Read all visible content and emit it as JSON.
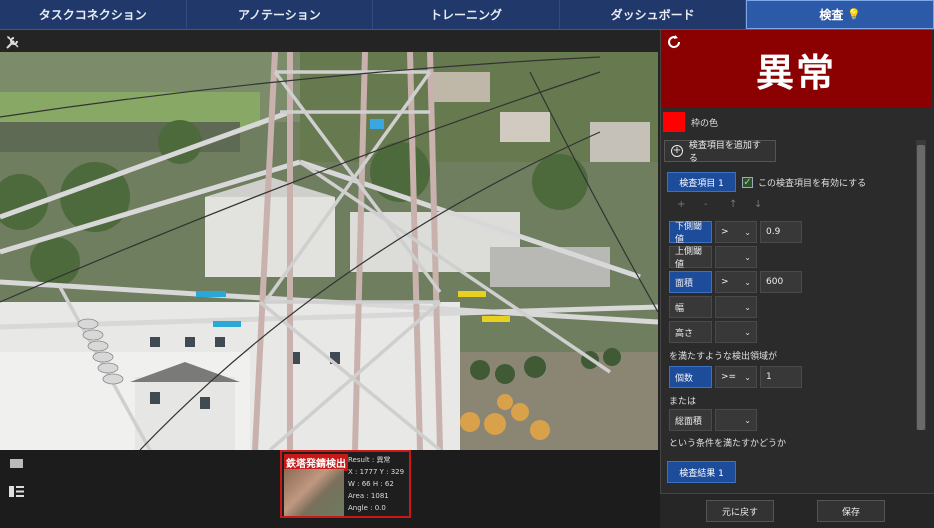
{
  "tabs": [
    {
      "label": "タスクコネクション"
    },
    {
      "label": "アノテーション"
    },
    {
      "label": "トレーニング"
    },
    {
      "label": "ダッシュボード"
    },
    {
      "label": "検査"
    }
  ],
  "active_tab_index": 4,
  "detection": {
    "label": "鉄塔発錆検出",
    "info": [
      "Result : 異常",
      "X : 1777 Y : 329",
      "W : 66 H : 62",
      "Area : 1081",
      "Angle : 0.0"
    ]
  },
  "panel": {
    "verdict": "異常",
    "verdict_color": "#8b0000",
    "frame_color_label": "枠の色",
    "frame_color": "#ff0000",
    "add_item_label": "検査項目を追加する",
    "item_tab_label": "検査項目 1",
    "enable_label": "この検査項目を有効にする",
    "enable_checked": true,
    "ops": [
      "+",
      "-",
      "↑",
      "↓"
    ],
    "conditions": [
      {
        "field": "下側閾値",
        "op": ">",
        "value": "0.9",
        "highlight": true
      },
      {
        "field": "上側閾値",
        "op": "",
        "value": "",
        "highlight": false
      },
      {
        "field": "面積",
        "op": ">",
        "value": "600",
        "highlight": true
      },
      {
        "field": "幅",
        "op": "",
        "value": "",
        "highlight": false
      },
      {
        "field": "高さ",
        "op": "",
        "value": "",
        "highlight": false
      }
    ],
    "satisfy_text": "を満たすような検出領域が",
    "count": {
      "field": "個数",
      "op": ">=",
      "value": "1"
    },
    "or_text": "または",
    "total_area": {
      "field": "総面積",
      "op": ""
    },
    "judge_text": "という条件を満たすかどうか",
    "result_tab_label": "検査結果 1",
    "undo_label": "元に戻す",
    "save_label": "保存"
  }
}
